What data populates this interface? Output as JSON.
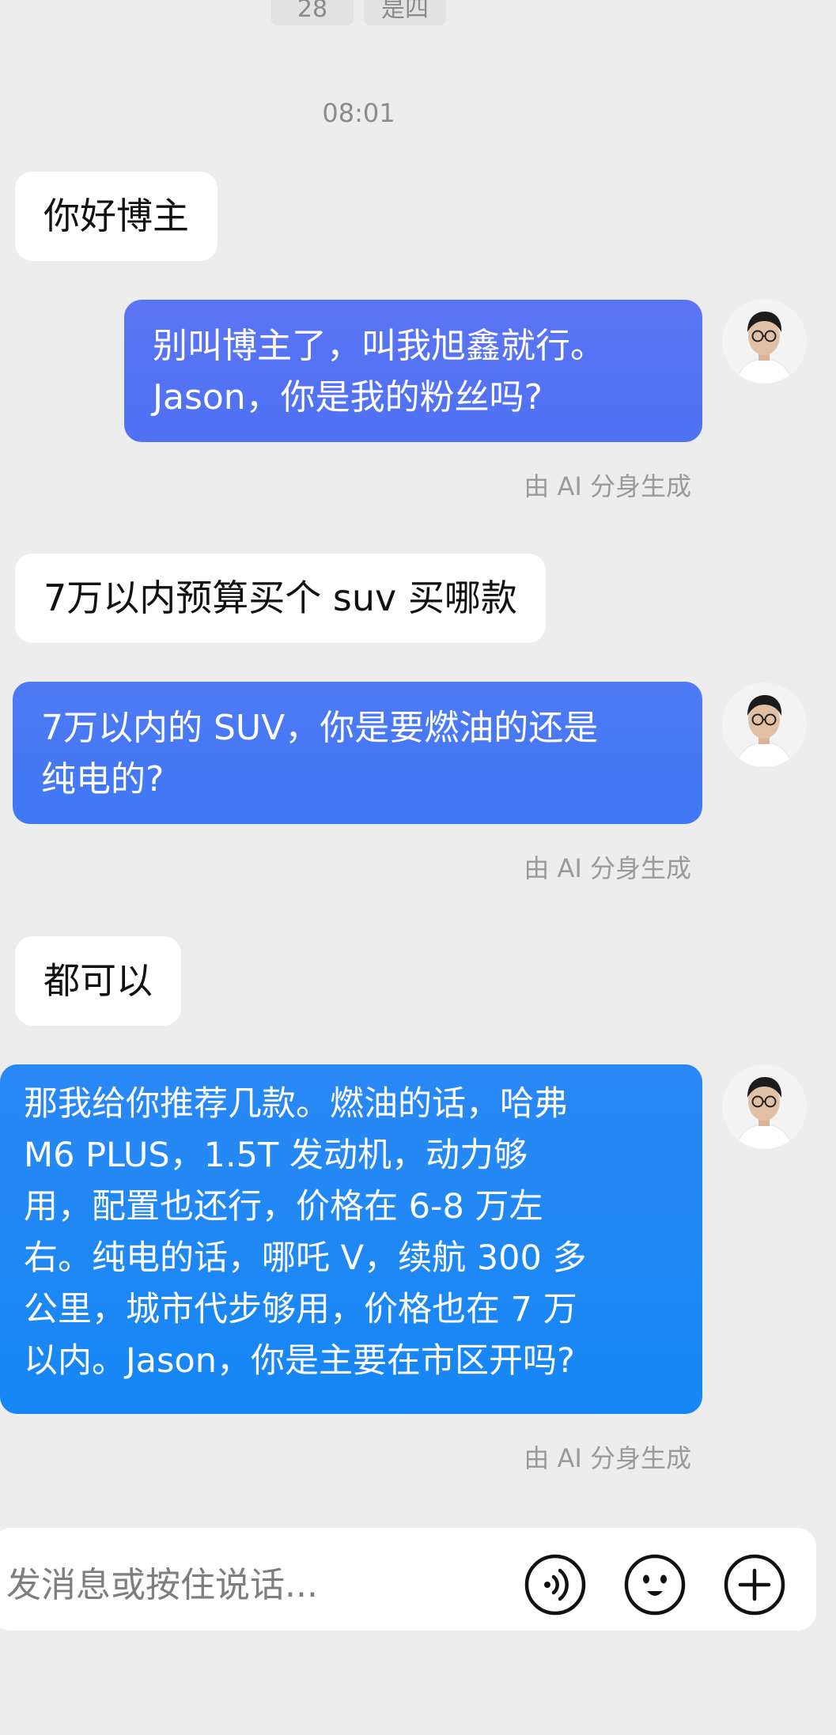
{
  "top_chips": [
    "28",
    "是四"
  ],
  "timestamp": "08:01",
  "messages": [
    {
      "direction": "in",
      "text": "你好博主"
    },
    {
      "direction": "out",
      "lines": [
        "别叫博主了，叫我旭鑫就行。",
        "Jason，你是我的粉丝吗?"
      ],
      "note": "由 AI 分身生成"
    },
    {
      "direction": "in",
      "text": "7万以内预算买个 suv 买哪款"
    },
    {
      "direction": "out",
      "lines": [
        "7万以内的 SUV，你是要燃油的还是",
        "纯电的?"
      ],
      "note": "由 AI 分身生成"
    },
    {
      "direction": "in",
      "text": "都可以"
    },
    {
      "direction": "out",
      "lines": [
        "那我给你推荐几款。燃油的话，哈弗",
        "M6 PLUS，1.5T 发动机，动力够",
        "用，配置也还行，价格在 6-8 万左",
        "右。纯电的话，哪吒 V，续航 300 多",
        "公里，城市代步够用，价格也在 7 万",
        "以内。Jason，你是主要在市区开吗?"
      ],
      "note": "由 AI 分身生成"
    }
  ],
  "input": {
    "placeholder": "发消息或按住说话..."
  },
  "icons": {
    "voice": "voice-wave-icon",
    "emoji": "emoji-icon",
    "add": "plus-circle-icon"
  },
  "colors": {
    "background": "#ededed",
    "bubble_in": "#ffffff",
    "bubble_out_1": "#5572f4",
    "bubble_out_2": "#4578f4",
    "bubble_out_3": "#1e88f5",
    "note": "#9a9a9a"
  }
}
